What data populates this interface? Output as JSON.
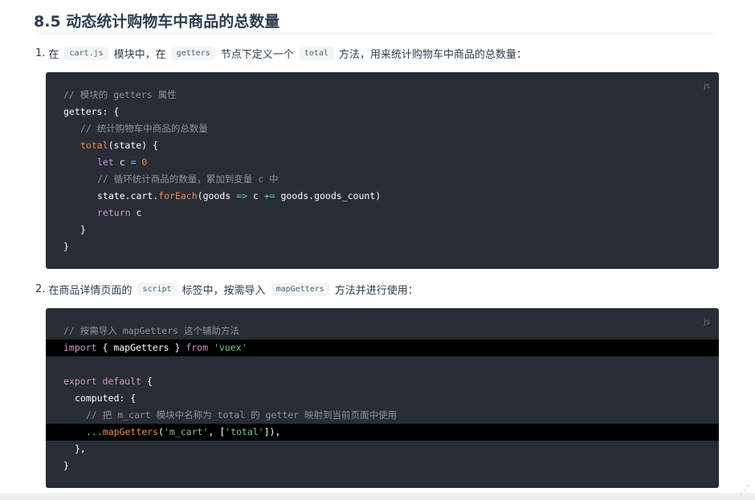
{
  "heading": "8.5 动态统计购物车中商品的总数量",
  "step1": {
    "num": "1.",
    "t1": "在",
    "chip1": "cart.js",
    "t2": "模块中，在",
    "chip2": "getters",
    "t3": "节点下定义一个",
    "chip3": "total",
    "t4": "方法，用来统计购物车中商品的总数量："
  },
  "code1": {
    "lang": "js",
    "l1": "// 模块的 getters 属性",
    "l2_a": "getters",
    "l2_b": ": {",
    "l3": "// 统计购物车中商品的总数量",
    "l4_a": "total",
    "l4_b": "(state) {",
    "l5_kw": "let",
    "l5_b": " c ",
    "l5_op": "=",
    "l5_num": " 0",
    "l6": "// 循环统计商品的数量，累加到变量 c 中",
    "l7_a": "state.cart.",
    "l7_fn": "forEach",
    "l7_b": "(goods ",
    "l7_op1": "=>",
    "l7_c": " c ",
    "l7_op2": "+=",
    "l7_d": " goods.goods_count)",
    "l8_kw": "return",
    "l8_b": " c",
    "l9": "}",
    "l10": "}"
  },
  "step2": {
    "num": "2.",
    "t1": "在商品详情页面的",
    "chip1": "script",
    "t2": "标签中，按需导入",
    "chip2": "mapGetters",
    "t3": "方法并进行使用："
  },
  "code2": {
    "lang": "js",
    "l1": "// 按需导入 mapGetters 这个辅助方法",
    "l2_kw": "import",
    "l2_b": " { mapGetters } ",
    "l2_kw2": "from",
    "l2_str": " 'vuex'",
    "l4_kw": "export default",
    "l4_b": " {",
    "l5": "computed: {",
    "l6": "// 把 m_cart 模块中名称为 total 的 getter 映射到当前页面中使用",
    "l7_op": "...",
    "l7_fn": "mapGetters",
    "l7_b": "(",
    "l7_s1": "'m_cart'",
    "l7_c": ", [",
    "l7_s2": "'total'",
    "l7_d": "]),",
    "l8": "},",
    "l9": "}"
  }
}
